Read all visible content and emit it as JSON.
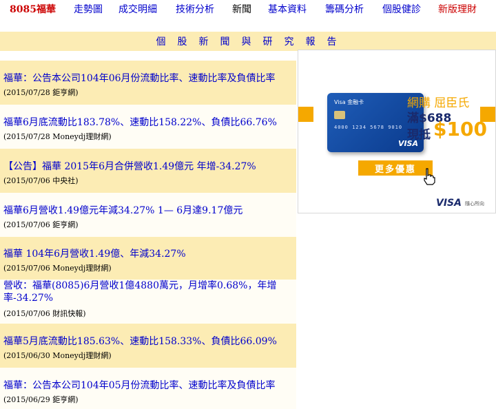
{
  "nav": {
    "stock": "8085福華",
    "items": [
      {
        "label": "走勢圖"
      },
      {
        "label": "成交明細"
      },
      {
        "label": "技術分析"
      },
      {
        "label": "新聞"
      },
      {
        "label": "基本資料"
      },
      {
        "label": "籌碼分析"
      },
      {
        "label": "個股健診"
      },
      {
        "label": "新版理財"
      }
    ]
  },
  "section_title": "個股新聞與研究報告",
  "news": [
    {
      "title": "福華：公告本公司104年06月份流動比率、速動比率及負債比率",
      "meta": "(2015/07/28 鉅亨網)"
    },
    {
      "title": "福華6月底流動比183.78%、速動比158.22%、負債比66.76%",
      "meta": "(2015/07/28 Moneydj理財網)"
    },
    {
      "title": "【公告】福華 2015年6月合併營收1.49億元 年增-34.27%",
      "meta": "(2015/07/06 中央社)"
    },
    {
      "title": "福華6月營收1.49億元年減34.27% 1— 6月達9.17億元",
      "meta": "(2015/07/06 鉅亨網)"
    },
    {
      "title": "福華 104年6月營收1.49億、年減34.27%",
      "meta": "(2015/07/06 Moneydj理財網)"
    },
    {
      "title": "營收：福華(8085)6月營收1億4880萬元，月增率0.68%，年增率-34.27%",
      "meta": "(2015/07/06 財訊快報)"
    },
    {
      "title": "福華5月底流動比185.63%、速動比158.33%、負債比66.09%",
      "meta": "(2015/06/30 Moneydj理財網)"
    },
    {
      "title": "福華：公告本公司104年05月份流動比率、速動比率及負債比率",
      "meta": "(2015/06/29 鉅亨網)"
    }
  ],
  "ad": {
    "card_title": "Visa 金融卡",
    "card_number": "4000 1234 5678 9010",
    "card_brand": "VISA",
    "promo_line1": "網購 屈臣氏",
    "promo_line2": "滿$688",
    "promo_line3_label": "現抵",
    "promo_line3_amount": "$100",
    "button": "更多優惠",
    "logo": "VISA",
    "slogan": "隨心所向",
    "accent": "#f5a800"
  }
}
